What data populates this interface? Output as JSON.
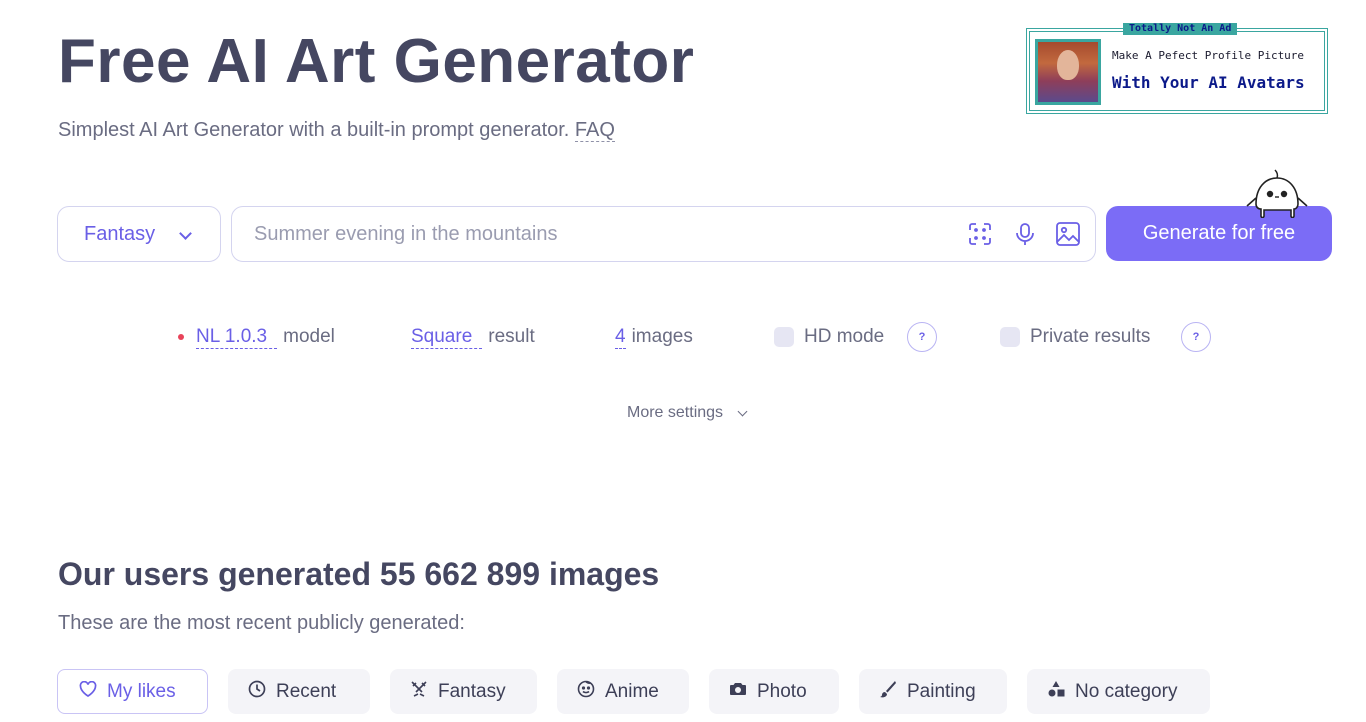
{
  "header": {
    "title": "Free AI Art Generator",
    "subtitle": "Simplest AI Art Generator with a built-in prompt generator.",
    "faq_link": "FAQ"
  },
  "ad": {
    "tag": "Totally Not An Ad",
    "line1": "Make A Pefect Profile Picture",
    "line2": "With Your AI Avatars"
  },
  "prompt": {
    "style_selected": "Fantasy",
    "placeholder": "Summer evening in the mountains",
    "value": "",
    "generate_label": "Generate for free",
    "icons": [
      "expand-icon",
      "microphone-icon",
      "image-icon"
    ]
  },
  "settings": {
    "model_value": "NL 1.0.3",
    "model_label": "model",
    "size_value": "Square",
    "size_label": "result",
    "count_value": "4",
    "count_label": "images",
    "hd_label": "HD mode",
    "hd_checked": false,
    "private_label": "Private results",
    "private_checked": false,
    "help_glyph": "?",
    "more_label": "More settings"
  },
  "stats": {
    "title": "Our users generated 55 662 899 images",
    "subtitle": "These are the most recent publicly generated:"
  },
  "categories": [
    {
      "label": "My likes",
      "icon": "heart-icon",
      "active": true
    },
    {
      "label": "Recent",
      "icon": "clock-icon",
      "active": false
    },
    {
      "label": "Fantasy",
      "icon": "swords-icon",
      "active": false
    },
    {
      "label": "Anime",
      "icon": "smiley-icon",
      "active": false
    },
    {
      "label": "Photo",
      "icon": "camera-icon",
      "active": false
    },
    {
      "label": "Painting",
      "icon": "brush-icon",
      "active": false
    },
    {
      "label": "No category",
      "icon": "shapes-icon",
      "active": false
    }
  ],
  "colors": {
    "accent": "#7b6cf6",
    "accent_text": "#6a5fe6",
    "heading": "#454761",
    "muted": "#6a6c82",
    "ad_teal": "#3aa6a0",
    "ad_navy": "#0c1a8a",
    "model_dot": "#e8435a"
  }
}
